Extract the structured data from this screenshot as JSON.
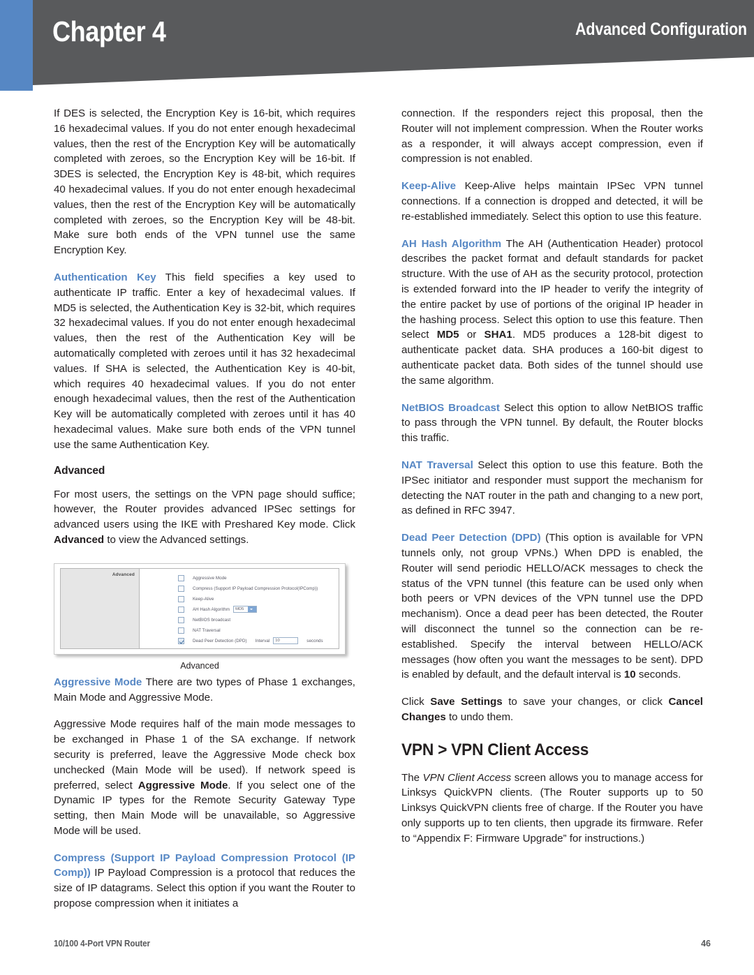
{
  "header": {
    "chapter": "Chapter 4",
    "section": "Advanced Configuration",
    "colors": {
      "accent_blue": "#5687c4",
      "bar_gray": "#595a5c"
    }
  },
  "left_column": {
    "p_des": {
      "text": "If DES is selected, the Encryption Key is 16-bit, which requires 16 hexadecimal values. If you do not enter enough hexadecimal values, then the rest of the Encryption Key will be automatically completed with zeroes, so the Encryption Key will be 16-bit. If 3DES is selected, the Encryption Key is 48-bit, which requires 40 hexadecimal values. If you do not enter enough hexadecimal values, then the rest of the Encryption Key will be automatically completed with zeroes, so the Encryption Key will be 48-bit. Make sure both ends of the VPN tunnel use the same Encryption Key."
    },
    "p_auth_key": {
      "term": "Authentication Key",
      "text": "This field specifies a key used to authenticate IP traffic. Enter a key of hexadecimal values. If MD5 is selected, the Authentication Key is 32-bit, which requires 32 hexadecimal values. If you do not enter enough hexadecimal values, then the rest of the Authentication Key will be automatically completed with zeroes until it has 32 hexadecimal values. If SHA is selected, the Authentication Key is 40-bit, which requires 40 hexadecimal values. If you do not enter enough hexadecimal values, then the rest of the Authentication Key will be automatically completed with zeroes until it has 40 hexadecimal values. Make sure both ends of the VPN tunnel use the same Authentication Key."
    },
    "heading_advanced": "Advanced",
    "p_advanced_intro_a": "For most users, the settings on the VPN page should suffice; however, the Router provides advanced IPSec settings for advanced users using the IKE with Preshared Key mode. Click ",
    "p_advanced_intro_bold": "Advanced",
    "p_advanced_intro_b": " to view the Advanced settings.",
    "figure": {
      "caption": "Advanced",
      "pane_label": "Advanced",
      "rows": [
        {
          "label": "Aggressive Mode",
          "checked": false
        },
        {
          "label": "Compress (Support IP Payload Compression Protocol(IPComp))",
          "checked": false
        },
        {
          "label": "Keep-Alive",
          "checked": false
        },
        {
          "label": "AH Hash Algorithm",
          "checked": false,
          "select_value": "MD5"
        },
        {
          "label": "NetBIOS broadcast",
          "checked": false
        },
        {
          "label": "NAT Traversal",
          "checked": false
        },
        {
          "label": "Dead Peer Detection (DPD)",
          "checked": true,
          "interval_label": "Interval",
          "interval_value": "10",
          "unit_label": "seconds"
        }
      ]
    },
    "p_aggressive": {
      "term": "Aggressive Mode",
      "text": "There are two types of Phase 1 exchanges, Main Mode and Aggressive Mode."
    },
    "p_aggressive_2_a": "Aggressive Mode requires half of the main mode messages to be exchanged in Phase 1 of the SA exchange. If network security is preferred, leave the Aggressive Mode check box unchecked (Main Mode will be used). If network speed is preferred, select ",
    "p_aggressive_2_bold": "Aggressive Mode",
    "p_aggressive_2_b": ". If you select one of the Dynamic IP types for the Remote Security Gateway Type setting, then Main Mode will be unavailable, so Aggressive Mode will be used.",
    "p_compress": {
      "term": "Compress (Support IP Payload Compression Protocol (IP Comp))",
      "text": "IP Payload Compression is a protocol that reduces the size of IP datagrams. Select this option if you want the Router to propose compression when it initiates a"
    }
  },
  "right_column": {
    "p_connection": "connection. If the responders reject this proposal, then the Router will not implement compression. When the Router works as a responder, it will always accept compression, even if compression is not enabled.",
    "p_keepalive": {
      "term": "Keep-Alive",
      "text": "Keep-Alive helps maintain IPSec VPN tunnel connections. If a connection is dropped and detected, it will be re-established immediately. Select this option to use this feature."
    },
    "p_ah_hash": {
      "term": "AH Hash Algorithm",
      "text_a": "The AH (Authentication Header) protocol describes the packet format and default standards for packet structure. With the use of AH as the security protocol, protection is extended forward into the IP header to verify the integrity of the entire packet by use of portions of the original IP header in the hashing process. Select this option to use this feature. Then select ",
      "bold_1": "MD5",
      "text_b": " or ",
      "bold_2": "SHA1",
      "text_c": ". MD5 produces a 128-bit digest to authenticate packet data. SHA produces a 160-bit digest to authenticate packet data. Both sides of the tunnel should use the same algorithm."
    },
    "p_netbios": {
      "term": "NetBIOS Broadcast",
      "text": "Select this option to allow NetBIOS traffic to pass through the VPN tunnel. By default, the Router blocks this traffic."
    },
    "p_nat": {
      "term": "NAT Traversal",
      "text": "Select this option to use this feature. Both the IPSec initiator and responder must support the mechanism for detecting the NAT router in the path and changing to a new port, as defined in RFC 3947."
    },
    "p_dpd": {
      "term": "Dead Peer Detection (DPD)",
      "text_a": "(This option is available for VPN tunnels only, not group VPNs.) When DPD is enabled, the Router will send periodic HELLO/ACK messages to check the status of the VPN tunnel (this feature can be used only when both peers or VPN devices of the VPN tunnel use the DPD mechanism). Once a dead peer has been detected, the Router will disconnect the tunnel so the connection can be re-established. Specify the interval between HELLO/ACK messages (how often you want the messages to be sent). DPD is enabled by default, and the default interval is ",
      "bold_1": "10",
      "text_b": " seconds."
    },
    "p_save": {
      "text_a": "Click ",
      "bold_1": "Save Settings",
      "text_b": " to save your changes, or click ",
      "bold_2": "Cancel Changes",
      "text_c": " to undo them."
    },
    "heading_vpn": "VPN > VPN Client Access",
    "p_vpn_client_a": "The ",
    "p_vpn_client_ital": "VPN Client Access",
    "p_vpn_client_b": " screen allows you to manage access for Linksys QuickVPN clients. (The Router supports up to 50 Linksys QuickVPN clients free of charge. If the Router you have only supports up to ten clients, then upgrade its firmware. Refer to “Appendix F: Firmware Upgrade” for instructions.)"
  },
  "footer": {
    "product": "10/100 4-Port VPN Router",
    "page_number": "46"
  }
}
